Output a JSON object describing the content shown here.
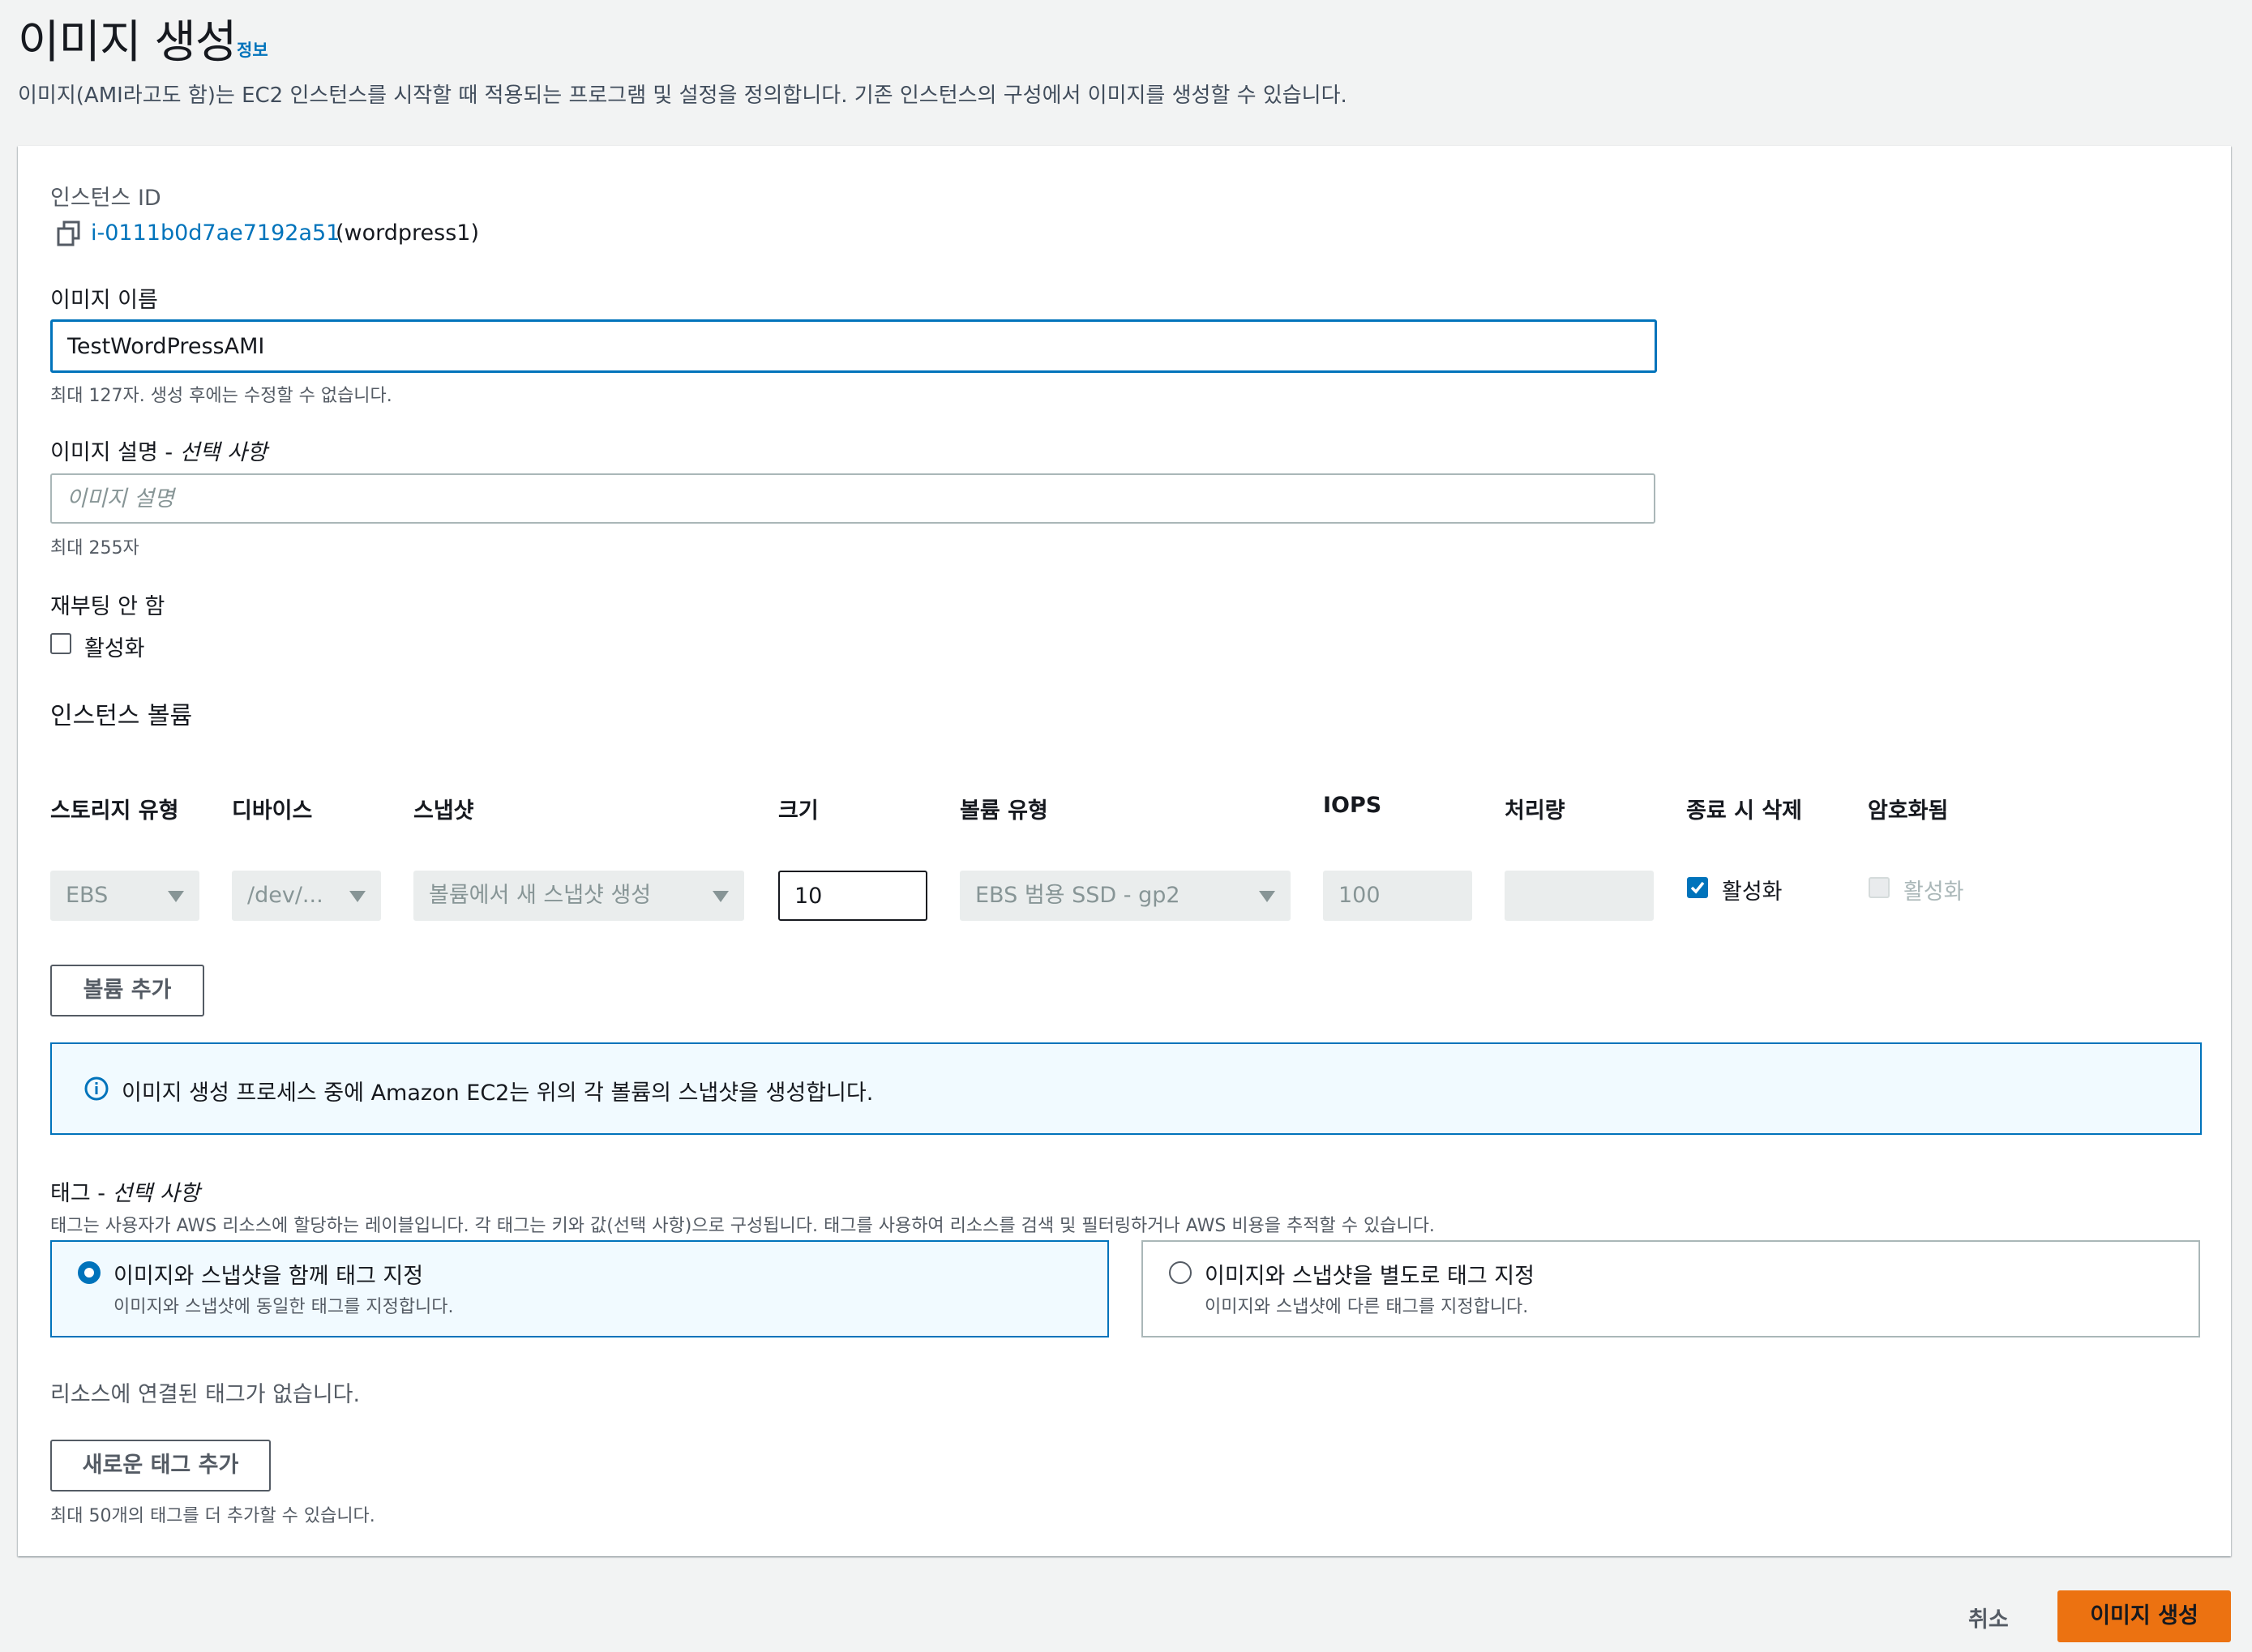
{
  "header": {
    "title": "이미지 생성",
    "info_link": "정보",
    "description": "이미지(AMI라고도 함)는 EC2 인스턴스를 시작할 때 적용되는 프로그램 및 설정을 정의합니다. 기존 인스턴스의 구성에서 이미지를 생성할 수 있습니다."
  },
  "instance": {
    "label": "인스턴스 ID",
    "id": "i-0111b0d7ae7192a51",
    "name": "(wordpress1)",
    "copy_icon": "copy-icon"
  },
  "image_name": {
    "label": "이미지 이름",
    "value": "TestWordPressAMI",
    "hint": "최대 127자. 생성 후에는 수정할 수 없습니다."
  },
  "image_description": {
    "label": "이미지 설명 - ",
    "label_optional": "선택 사항",
    "placeholder": "이미지 설명",
    "value": "",
    "hint": "최대 255자"
  },
  "no_reboot": {
    "label": "재부팅 안 함",
    "checkbox_label": "활성화",
    "checked": false
  },
  "volumes": {
    "title": "인스턴스 볼륨",
    "columns": [
      "스토리지 유형",
      "디바이스",
      "스냅샷",
      "크기",
      "볼륨 유형",
      "IOPS",
      "처리량",
      "종료 시 삭제",
      "암호화됨"
    ],
    "row": {
      "storage_type": "EBS",
      "device": "/dev/...",
      "snapshot": "볼륨에서 새 스냅샷 생성",
      "size": "10",
      "volume_type": "EBS 범용 SSD - gp2",
      "iops": "100",
      "throughput": "",
      "delete_on_termination": {
        "label": "활성화",
        "checked": true
      },
      "encrypted": {
        "label": "활성화",
        "checked": false,
        "disabled": true
      }
    },
    "add_button": "볼륨 추가"
  },
  "alert": {
    "icon": "info-icon",
    "text": "이미지 생성 프로세스 중에 Amazon EC2는 위의 각 볼륨의 스냅샷을 생성합니다."
  },
  "tags": {
    "label": "태그 - ",
    "label_optional": "선택 사항",
    "description": "태그는 사용자가 AWS 리소스에 할당하는 레이블입니다. 각 태그는 키와 값(선택 사항)으로 구성됩니다. 태그를 사용하여 리소스를 검색 및 필터링하거나 AWS 비용을 추적할 수 있습니다.",
    "options": [
      {
        "title": "이미지와 스냅샷을 함께 태그 지정",
        "description": "이미지와 스냅샷에 동일한 태그를 지정합니다.",
        "selected": true
      },
      {
        "title": "이미지와 스냅샷을 별도로 태그 지정",
        "description": "이미지와 스냅샷에 다른 태그를 지정합니다.",
        "selected": false
      }
    ],
    "empty_text": "리소스에 연결된 태그가 없습니다.",
    "add_button": "새로운 태그 추가",
    "limit_hint": "최대 50개의 태그를 더 추가할 수 있습니다."
  },
  "footer": {
    "cancel": "취소",
    "submit": "이미지 생성"
  },
  "colors": {
    "accent": "#0073bb",
    "primary_button": "#ec7211",
    "background": "#f2f3f3"
  }
}
